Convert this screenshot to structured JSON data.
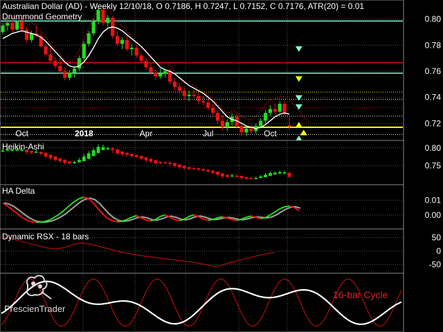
{
  "header": {
    "title": "Australian Dollar (AD) - Weekly 12/10/18, O 0.7186, H 0.7247, L 0.7152, C 0.7176, ATR(20) = 0.01",
    "subtitle": "Drummond Geometry"
  },
  "logo": {
    "text": "PrescienTrader",
    "icon": "bull-bear-logo-icon"
  },
  "colors": {
    "up": "#22dd22",
    "down": "#ee1111",
    "ma": "#ffffff",
    "dotted": "#cc1111",
    "yellow": "#ffff00",
    "cyan": "#7fffd4",
    "grid": "#5a5a5a"
  },
  "chart_data": [
    {
      "name": "price",
      "type": "candlestick",
      "title": "Drummond Geometry",
      "x_ticks": [
        {
          "label": "Oct",
          "i": 4
        },
        {
          "label": "2018",
          "i": 17,
          "bold": true
        },
        {
          "label": "Apr",
          "i": 30
        },
        {
          "label": "Jul",
          "i": 43
        },
        {
          "label": "Oct",
          "i": 56
        }
      ],
      "y_ticks": [
        0.8,
        0.78,
        0.76,
        0.74,
        0.72
      ],
      "ylim": [
        0.7085,
        0.8125
      ],
      "ohlc": [
        [
          0.79,
          0.797,
          0.788,
          0.795
        ],
        [
          0.795,
          0.8,
          0.791,
          0.797
        ],
        [
          0.797,
          0.799,
          0.79,
          0.792
        ],
        [
          0.792,
          0.799,
          0.791,
          0.798
        ],
        [
          0.798,
          0.801,
          0.79,
          0.792
        ],
        [
          0.792,
          0.794,
          0.782,
          0.784
        ],
        [
          0.784,
          0.791,
          0.782,
          0.789
        ],
        [
          0.789,
          0.795,
          0.786,
          0.787
        ],
        [
          0.787,
          0.789,
          0.778,
          0.779
        ],
        [
          0.779,
          0.781,
          0.771,
          0.773
        ],
        [
          0.773,
          0.778,
          0.766,
          0.768
        ],
        [
          0.768,
          0.771,
          0.762,
          0.764
        ],
        [
          0.764,
          0.77,
          0.758,
          0.76
        ],
        [
          0.76,
          0.763,
          0.753,
          0.755
        ],
        [
          0.755,
          0.761,
          0.753,
          0.759
        ],
        [
          0.759,
          0.764,
          0.755,
          0.762
        ],
        [
          0.762,
          0.772,
          0.76,
          0.77
        ],
        [
          0.77,
          0.783,
          0.768,
          0.781
        ],
        [
          0.781,
          0.791,
          0.779,
          0.789
        ],
        [
          0.789,
          0.8,
          0.787,
          0.798
        ],
        [
          0.798,
          0.81,
          0.796,
          0.807
        ],
        [
          0.807,
          0.809,
          0.795,
          0.797
        ],
        [
          0.797,
          0.803,
          0.794,
          0.801
        ],
        [
          0.801,
          0.802,
          0.785,
          0.787
        ],
        [
          0.787,
          0.791,
          0.779,
          0.781
        ],
        [
          0.781,
          0.786,
          0.777,
          0.784
        ],
        [
          0.784,
          0.788,
          0.775,
          0.777
        ],
        [
          0.777,
          0.781,
          0.772,
          0.778
        ],
        [
          0.778,
          0.78,
          0.77,
          0.772
        ],
        [
          0.772,
          0.774,
          0.766,
          0.768
        ],
        [
          0.768,
          0.77,
          0.761,
          0.763
        ],
        [
          0.763,
          0.766,
          0.757,
          0.759
        ],
        [
          0.759,
          0.761,
          0.753,
          0.756
        ],
        [
          0.756,
          0.762,
          0.754,
          0.758
        ],
        [
          0.758,
          0.762,
          0.755,
          0.76
        ],
        [
          0.76,
          0.762,
          0.75,
          0.752
        ],
        [
          0.752,
          0.755,
          0.745,
          0.748
        ],
        [
          0.748,
          0.751,
          0.742,
          0.745
        ],
        [
          0.745,
          0.748,
          0.738,
          0.741
        ],
        [
          0.741,
          0.745,
          0.737,
          0.742
        ],
        [
          0.742,
          0.746,
          0.739,
          0.741
        ],
        [
          0.741,
          0.744,
          0.735,
          0.737
        ],
        [
          0.737,
          0.741,
          0.734,
          0.736
        ],
        [
          0.736,
          0.739,
          0.73,
          0.732
        ],
        [
          0.732,
          0.735,
          0.726,
          0.728
        ],
        [
          0.728,
          0.73,
          0.72,
          0.722
        ],
        [
          0.722,
          0.726,
          0.715,
          0.717
        ],
        [
          0.717,
          0.723,
          0.714,
          0.721
        ],
        [
          0.721,
          0.728,
          0.718,
          0.725
        ],
        [
          0.725,
          0.727,
          0.716,
          0.718
        ],
        [
          0.718,
          0.721,
          0.71,
          0.713
        ],
        [
          0.713,
          0.718,
          0.71,
          0.716
        ],
        [
          0.716,
          0.719,
          0.712,
          0.714
        ],
        [
          0.714,
          0.72,
          0.712,
          0.718
        ],
        [
          0.718,
          0.724,
          0.716,
          0.722
        ],
        [
          0.722,
          0.73,
          0.72,
          0.728
        ],
        [
          0.728,
          0.734,
          0.726,
          0.731
        ],
        [
          0.731,
          0.735,
          0.727,
          0.729
        ],
        [
          0.729,
          0.737,
          0.728,
          0.735
        ],
        [
          0.735,
          0.737,
          0.726,
          0.728
        ],
        [
          0.7186,
          0.7247,
          0.7152,
          0.7176
        ]
      ],
      "ma": [
        0.785,
        0.787,
        0.789,
        0.79,
        0.791,
        0.79,
        0.789,
        0.788,
        0.786,
        0.783,
        0.779,
        0.775,
        0.771,
        0.767,
        0.764,
        0.763,
        0.764,
        0.767,
        0.772,
        0.778,
        0.785,
        0.79,
        0.793,
        0.794,
        0.793,
        0.791,
        0.788,
        0.785,
        0.782,
        0.779,
        0.775,
        0.771,
        0.767,
        0.763,
        0.761,
        0.76,
        0.758,
        0.755,
        0.752,
        0.749,
        0.747,
        0.745,
        0.743,
        0.74,
        0.737,
        0.733,
        0.729,
        0.725,
        0.723,
        0.722,
        0.72,
        0.718,
        0.717,
        0.716,
        0.717,
        0.719,
        0.722,
        0.725,
        0.727,
        0.728,
        0.727
      ],
      "dotted": [
        0.795,
        0.799,
        0.802,
        0.798,
        0.8,
        0.795,
        0.797,
        0.794,
        0.79,
        0.786,
        0.78,
        0.776,
        0.772,
        0.768,
        0.767,
        0.77,
        0.777,
        0.786,
        0.794,
        0.802,
        0.809,
        0.806,
        0.808,
        0.802,
        0.797,
        0.794,
        0.79,
        0.786,
        0.782,
        0.778,
        0.774,
        0.77,
        0.766,
        0.765,
        0.767,
        0.764,
        0.758,
        0.754,
        0.751,
        0.75,
        0.749,
        0.746,
        0.744,
        0.741,
        0.738,
        0.734,
        0.73,
        0.728,
        0.73,
        0.728,
        0.725,
        0.723,
        0.723,
        0.726,
        0.73,
        0.735,
        0.738,
        0.739,
        0.741,
        0.74,
        0.737,
        0.733,
        0.729,
        0.724,
        0.721
      ],
      "hlines": [
        {
          "y": 0.7985,
          "color": "#7fffd4",
          "style": "solid",
          "width": 1.5
        },
        {
          "y": 0.7665,
          "color": "#cc1111",
          "style": "solid",
          "width": 1.5
        },
        {
          "y": 0.7585,
          "color": "#7fffd4",
          "style": "solid",
          "width": 1.5
        },
        {
          "y": 0.744,
          "color": "#ffff00",
          "style": "dotted",
          "width": 1
        },
        {
          "y": 0.7385,
          "color": "#ffffff",
          "style": "dotted",
          "width": 1
        },
        {
          "y": 0.732,
          "color": "#cc1111",
          "style": "dotted",
          "width": 1
        },
        {
          "y": 0.7255,
          "color": "#ffffff",
          "style": "dotted",
          "width": 1
        },
        {
          "y": 0.717,
          "color": "#ffff00",
          "style": "solid",
          "width": 2
        },
        {
          "y": 0.7115,
          "color": "#ffffff",
          "style": "dotted",
          "width": 1
        }
      ],
      "markers": [
        {
          "i": 62,
          "y": 0.777,
          "dir": "down",
          "color": "#7fffd4"
        },
        {
          "i": 62,
          "y": 0.754,
          "dir": "down",
          "color": "#ffff00"
        },
        {
          "i": 62,
          "y": 0.7395,
          "dir": "down",
          "color": "#7fffd4"
        },
        {
          "i": 62,
          "y": 0.7325,
          "dir": "down",
          "color": "#7fffd4"
        },
        {
          "i": 62,
          "y": 0.719,
          "dir": "up",
          "color": "#ffff00"
        },
        {
          "i": 63,
          "y": 0.713,
          "dir": "up",
          "color": "#ffff00"
        },
        {
          "i": 62,
          "y": 0.7085,
          "dir": "up",
          "color": "#7fffd4"
        }
      ]
    },
    {
      "name": "heikin-ashi",
      "type": "candlestick",
      "title": "Heikin-Ashi",
      "y_ticks": [
        0.8,
        0.75
      ],
      "ylim": [
        0.703,
        0.815
      ]
    },
    {
      "name": "ha-delta",
      "type": "line",
      "title": "HA Delta",
      "y_ticks": [
        0.01,
        0.0
      ],
      "ylim": [
        -0.008,
        0.019
      ],
      "values": [
        0.008,
        0.006,
        0.0035,
        0.001,
        -0.0015,
        -0.0035,
        -0.0045,
        -0.005,
        -0.0048,
        -0.0042,
        -0.003,
        -0.0012,
        0.001,
        0.0035,
        0.0065,
        0.009,
        0.011,
        0.012,
        0.011,
        0.008,
        0.004,
        0.0005,
        -0.0025,
        -0.004,
        -0.0045,
        -0.0042,
        -0.003,
        -0.0015,
        -0.0005,
        -0.002,
        -0.0035,
        -0.004,
        -0.003,
        -0.001,
        0.0,
        -0.0015,
        -0.0032,
        -0.0038,
        -0.0028,
        -0.001,
        0.0,
        -0.0012,
        -0.0028,
        -0.0035,
        -0.003,
        -0.0018,
        -0.0012,
        -0.002,
        -0.0032,
        -0.0036,
        -0.0028,
        -0.0015,
        -0.0008,
        -0.0016,
        -0.0024,
        -0.0018,
        0.0,
        0.002,
        0.0042,
        0.0055,
        0.006,
        0.005,
        0.003
      ]
    },
    {
      "name": "dynamic-rsx",
      "type": "line",
      "title": "Dynamic RSX - 18 bars",
      "y_ticks": [
        50,
        0,
        -50
      ],
      "ylim": [
        -75,
        75
      ],
      "values": [
        50,
        47,
        44,
        41,
        37,
        33,
        29,
        25,
        21,
        17,
        13,
        10,
        8,
        9,
        12,
        16,
        21,
        26,
        29,
        30,
        28,
        25,
        21,
        17,
        13,
        9,
        5,
        1,
        -3,
        -6,
        -9,
        -12,
        -15,
        -17,
        -19,
        -21,
        -23,
        -25,
        -27,
        -29,
        -31,
        -33,
        -35,
        -37,
        -39,
        -41,
        -43,
        -46,
        -49,
        -52,
        -55,
        -58,
        -55,
        -50,
        -45,
        -41,
        -37,
        -33,
        -29,
        -25,
        -21,
        -17,
        -14,
        -11,
        -8,
        -6
      ]
    },
    {
      "name": "cycle",
      "type": "line",
      "title": "",
      "annotation": "16-bar Cycle",
      "ylim": [
        -1.1,
        1.1
      ]
    }
  ]
}
